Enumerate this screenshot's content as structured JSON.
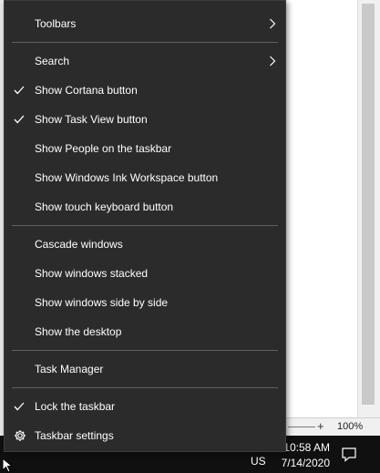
{
  "context_menu": {
    "items": [
      {
        "label": "Toolbars",
        "checked": false,
        "submenu": true,
        "icon": "chevron-right-icon"
      },
      {
        "label": "Search",
        "checked": false,
        "submenu": true,
        "icon": "chevron-right-icon"
      },
      {
        "label": "Show Cortana button",
        "checked": true,
        "submenu": false,
        "icon": "checkmark-icon"
      },
      {
        "label": "Show Task View button",
        "checked": true,
        "submenu": false,
        "icon": "checkmark-icon"
      },
      {
        "label": "Show People on the taskbar",
        "checked": false,
        "submenu": false
      },
      {
        "label": "Show Windows Ink Workspace button",
        "checked": false,
        "submenu": false
      },
      {
        "label": "Show touch keyboard button",
        "checked": false,
        "submenu": false
      },
      {
        "label": "Cascade windows",
        "checked": false,
        "submenu": false
      },
      {
        "label": "Show windows stacked",
        "checked": false,
        "submenu": false
      },
      {
        "label": "Show windows side by side",
        "checked": false,
        "submenu": false
      },
      {
        "label": "Show the desktop",
        "checked": false,
        "submenu": false
      },
      {
        "label": "Task Manager",
        "checked": false,
        "submenu": false
      },
      {
        "label": "Lock the taskbar",
        "checked": true,
        "submenu": false,
        "icon": "checkmark-icon"
      },
      {
        "label": "Taskbar settings",
        "checked": false,
        "submenu": false,
        "icon": "gear-icon"
      }
    ]
  },
  "status_bar": {
    "zoom_plus": "+",
    "zoom_level": "100%"
  },
  "taskbar": {
    "time": "10:58 AM",
    "date": "7/14/2020",
    "language": "US",
    "notification_icon": "action-center-icon"
  },
  "colors": {
    "menu_background": "#2b2b2b",
    "menu_text": "#ffffff",
    "separator": "#5f5f5f",
    "taskbar_background": "#101010"
  }
}
